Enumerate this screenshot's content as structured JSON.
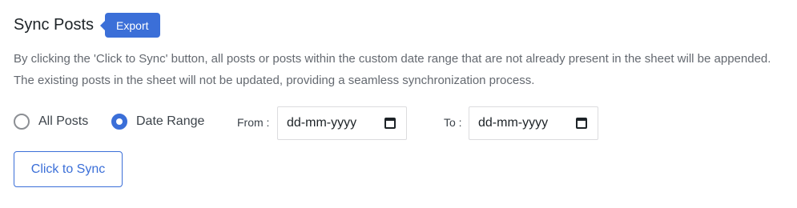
{
  "header": {
    "title": "Sync Posts",
    "export_label": "Export"
  },
  "description": "By clicking the 'Click to Sync' button, all posts or posts within the custom date range that are not already present in the sheet will be appended. The existing posts in the sheet will not be updated, providing a seamless synchronization process.",
  "options": {
    "all_posts_label": "All Posts",
    "date_range_label": "Date Range",
    "selected": "Date Range"
  },
  "date_range": {
    "from_label": "From :",
    "from_value": "dd-mm-yyyy",
    "to_label": "To :",
    "to_value": "dd-mm-yyyy"
  },
  "sync_button_label": "Click to Sync",
  "colors": {
    "accent": "#3b6fd8",
    "text": "#3c434a",
    "muted": "#646970",
    "border": "#dcdcde"
  },
  "icons": {
    "calendar": "calendar-icon"
  }
}
